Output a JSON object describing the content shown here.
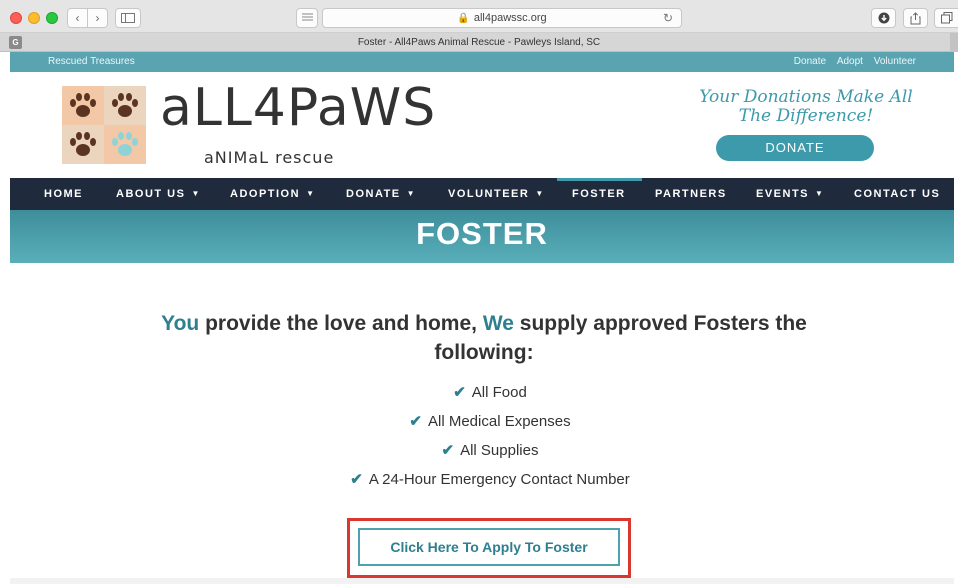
{
  "browser": {
    "url": "all4pawssc.org",
    "tab_title": "Foster - All4Paws Animal Rescue - Pawleys Island, SC",
    "favicon_letter": "G",
    "back_icon": "chevron-left-icon",
    "forward_icon": "chevron-right-icon"
  },
  "topbar": {
    "left_link": "Rescued Treasures",
    "right_links": [
      "Donate",
      "Adopt",
      "Volunteer"
    ]
  },
  "header": {
    "brand": "aLL4PaWS",
    "tagline": "aNIMaL rescue",
    "promo": "Your Donations Make All The Difference!",
    "donate_button": "DONATE",
    "logo_colors": [
      "#5b3522",
      "#5b3522",
      "#5b3522",
      "#8fd3d8"
    ]
  },
  "nav": {
    "items": [
      {
        "label": "HOME",
        "dropdown": false
      },
      {
        "label": "ABOUT US",
        "dropdown": true
      },
      {
        "label": "ADOPTION",
        "dropdown": true
      },
      {
        "label": "DONATE",
        "dropdown": true
      },
      {
        "label": "VOLUNTEER",
        "dropdown": true
      },
      {
        "label": "FOSTER",
        "dropdown": false,
        "active": true
      },
      {
        "label": "PARTNERS",
        "dropdown": false
      },
      {
        "label": "EVENTS",
        "dropdown": true
      },
      {
        "label": "CONTACT US",
        "dropdown": false
      }
    ]
  },
  "banner": {
    "title": "FOSTER"
  },
  "main": {
    "lead_you": "You",
    "lead_part1": " provide the love and home, ",
    "lead_we": "We",
    "lead_part2": " supply approved Fosters the following:",
    "list": [
      "All Food",
      "All Medical Expenses",
      "All Supplies",
      "A 24-Hour Emergency Contact Number"
    ],
    "apply_button": "Click Here To Apply To Foster"
  },
  "colors": {
    "accent": "#3c9aab",
    "nav_bg": "#1f2a3d",
    "highlight_box": "#d9382f"
  }
}
